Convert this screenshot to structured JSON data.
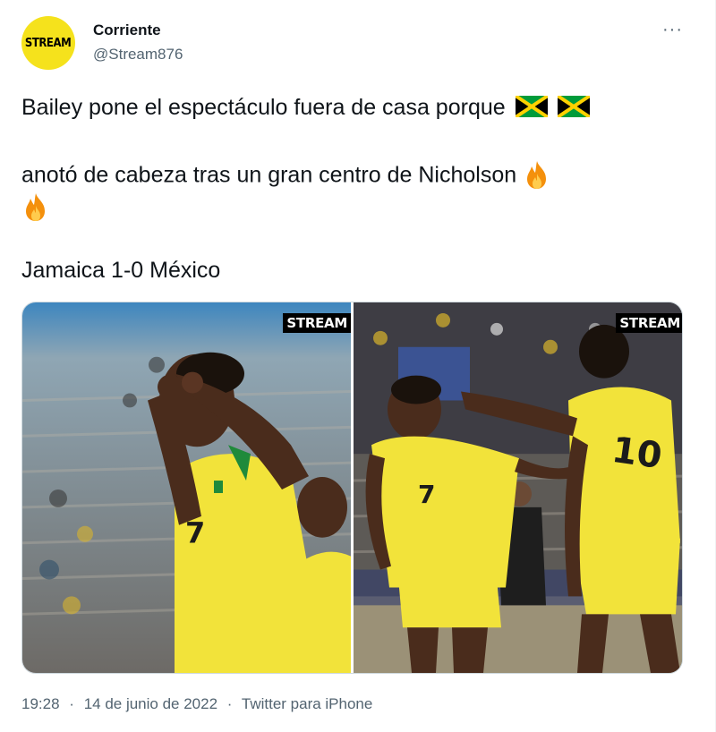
{
  "author": {
    "avatar_text": "STREAM",
    "display_name": "Corriente",
    "handle": "@Stream876"
  },
  "more_label": "···",
  "tweet": {
    "line1": "Bailey pone el espectáculo fuera de casa porque",
    "line2": "anotó de cabeza tras un gran centro de Nicholson",
    "line4": "Jamaica 1-0 México"
  },
  "media": {
    "watermark_1": "STREAM",
    "watermark_2": "STREAM"
  },
  "meta": {
    "time": "19:28",
    "dot1": "·",
    "date": "14 de junio de 2022",
    "dot2": "·",
    "source": "Twitter para iPhone"
  },
  "colors": {
    "brand_yellow": "#f5e21c",
    "jersey_yellow": "#f2e33a",
    "jersey_green": "#1f8a3b",
    "text_primary": "#0f1419",
    "text_secondary": "#536471"
  },
  "icons": [
    "jamaica-flag-emoji",
    "jamaica-flag-emoji",
    "fire-emoji",
    "fire-emoji",
    "more-icon"
  ]
}
